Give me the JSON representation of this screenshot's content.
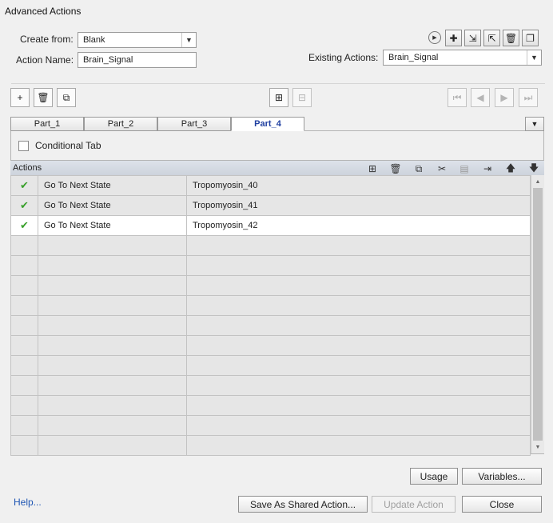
{
  "window": {
    "title": "Advanced Actions"
  },
  "form": {
    "create_from_label": "Create from:",
    "create_from_value": "Blank",
    "action_name_label": "Action Name:",
    "action_name_value": "Brain_Signal",
    "existing_actions_label": "Existing Actions:",
    "existing_actions_value": "Brain_Signal"
  },
  "tabs": [
    {
      "label": "Part_1",
      "active": false
    },
    {
      "label": "Part_2",
      "active": false
    },
    {
      "label": "Part_3",
      "active": false
    },
    {
      "label": "Part_4",
      "active": true
    }
  ],
  "conditional_tab": {
    "label": "Conditional Tab",
    "checked": false
  },
  "actions_table": {
    "header": "Actions",
    "rows": [
      {
        "status": "check",
        "action": "Go To Next State",
        "target": "Tropomyosin_40"
      },
      {
        "status": "check",
        "action": "Go To Next State",
        "target": "Tropomyosin_41"
      },
      {
        "status": "check",
        "action": "Go To Next State",
        "target": "Tropomyosin_42",
        "selected": true
      },
      {
        "status": "",
        "action": "",
        "target": ""
      },
      {
        "status": "",
        "action": "",
        "target": ""
      },
      {
        "status": "",
        "action": "",
        "target": ""
      },
      {
        "status": "",
        "action": "",
        "target": ""
      },
      {
        "status": "",
        "action": "",
        "target": ""
      },
      {
        "status": "",
        "action": "",
        "target": ""
      },
      {
        "status": "",
        "action": "",
        "target": ""
      },
      {
        "status": "",
        "action": "",
        "target": ""
      },
      {
        "status": "",
        "action": "",
        "target": ""
      },
      {
        "status": "",
        "action": "",
        "target": ""
      },
      {
        "status": "",
        "action": "",
        "target": ""
      }
    ]
  },
  "buttons": {
    "usage": "Usage",
    "variables": "Variables...",
    "save_shared": "Save As Shared Action...",
    "update_action": "Update Action",
    "close": "Close",
    "help": "Help..."
  },
  "icons": {
    "check_glyph": "✔",
    "accent_check_color": "#3aa02c",
    "link_color": "#1e55b3"
  }
}
